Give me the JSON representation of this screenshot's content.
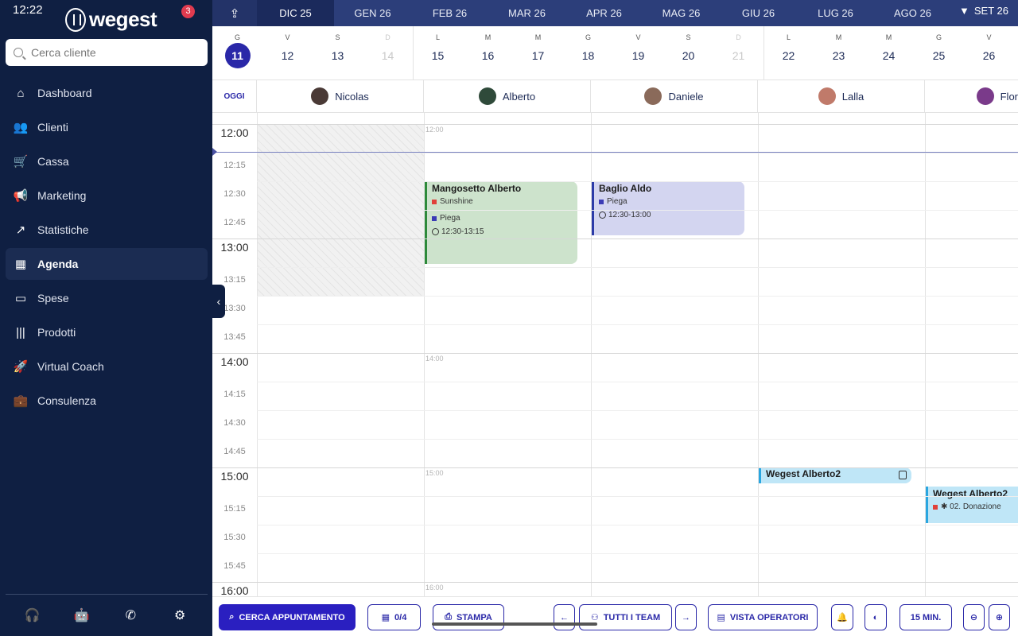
{
  "status": {
    "time": "12:22",
    "date_fragment": "SET 26"
  },
  "brand": {
    "name": "wegest",
    "notifications": "3"
  },
  "search": {
    "placeholder": "Cerca cliente"
  },
  "nav": [
    {
      "label": "Dashboard",
      "icon": "home-icon"
    },
    {
      "label": "Clienti",
      "icon": "users-icon"
    },
    {
      "label": "Cassa",
      "icon": "cart-icon"
    },
    {
      "label": "Marketing",
      "icon": "megaphone-icon"
    },
    {
      "label": "Statistiche",
      "icon": "chart-icon"
    },
    {
      "label": "Agenda",
      "icon": "calendar-icon",
      "active": true
    },
    {
      "label": "Spese",
      "icon": "money-icon"
    },
    {
      "label": "Prodotti",
      "icon": "barcode-icon"
    },
    {
      "label": "Virtual Coach",
      "icon": "rocket-icon"
    },
    {
      "label": "Consulenza",
      "icon": "briefcase-icon"
    }
  ],
  "months": [
    "DIC 25",
    "GEN 26",
    "FEB 26",
    "MAR 26",
    "APR 26",
    "MAG 26",
    "GIU 26",
    "LUG 26",
    "AGO 26"
  ],
  "days": [
    {
      "l": "G",
      "n": "11",
      "today": true
    },
    {
      "l": "V",
      "n": "12"
    },
    {
      "l": "S",
      "n": "13"
    },
    {
      "l": "D",
      "n": "14",
      "off": true
    },
    {
      "l": "L",
      "n": "15"
    },
    {
      "l": "M",
      "n": "16"
    },
    {
      "l": "M",
      "n": "17"
    },
    {
      "l": "G",
      "n": "18"
    },
    {
      "l": "V",
      "n": "19"
    },
    {
      "l": "S",
      "n": "20"
    },
    {
      "l": "D",
      "n": "21",
      "off": true
    },
    {
      "l": "L",
      "n": "22"
    },
    {
      "l": "M",
      "n": "23"
    },
    {
      "l": "M",
      "n": "24"
    },
    {
      "l": "G",
      "n": "25"
    },
    {
      "l": "V",
      "n": "26"
    }
  ],
  "today_label": "OGGI",
  "operators": [
    "Nicolas",
    "Alberto",
    "Daniele",
    "Lalla",
    "Flor"
  ],
  "times": [
    "12:00",
    "12:15",
    "12:30",
    "12:45",
    "13:00",
    "13:15",
    "13:30",
    "13:45",
    "14:00",
    "14:15",
    "14:30",
    "14:45",
    "15:00",
    "15:15",
    "15:30",
    "15:45",
    "16:00"
  ],
  "col_hour_labels": [
    "12:00",
    "14:00",
    "15:00",
    "16:00"
  ],
  "appointments": {
    "a1": {
      "name": "Mangosetto Alberto",
      "svc1": "Sunshine",
      "svc2": "Piega",
      "time": "12:30-13:15",
      "svc1_color": "#e0413a",
      "svc2_color": "#3b3bb5"
    },
    "a2": {
      "name": "Baglio Aldo",
      "svc1": "Piega",
      "time": "12:30-13:00",
      "svc1_color": "#3b3bb5"
    },
    "a3": {
      "name": "Wegest Alberto2"
    },
    "a4": {
      "name": "Wegest Alberto2",
      "svc1": "✱ 02. Donazione",
      "svc1_color": "#e0413a"
    }
  },
  "toolbar": {
    "search_appt": "CERCA APPUNTAMENTO",
    "counter": "0/4",
    "print": "STAMPA",
    "teams": "TUTTI I TEAM",
    "view": "VISTA OPERATORI",
    "interval": "15 MIN."
  },
  "colors": {
    "sidebar": "#0f1f42",
    "accent": "#2a28a8",
    "month_bar": "#2c3e7a"
  }
}
